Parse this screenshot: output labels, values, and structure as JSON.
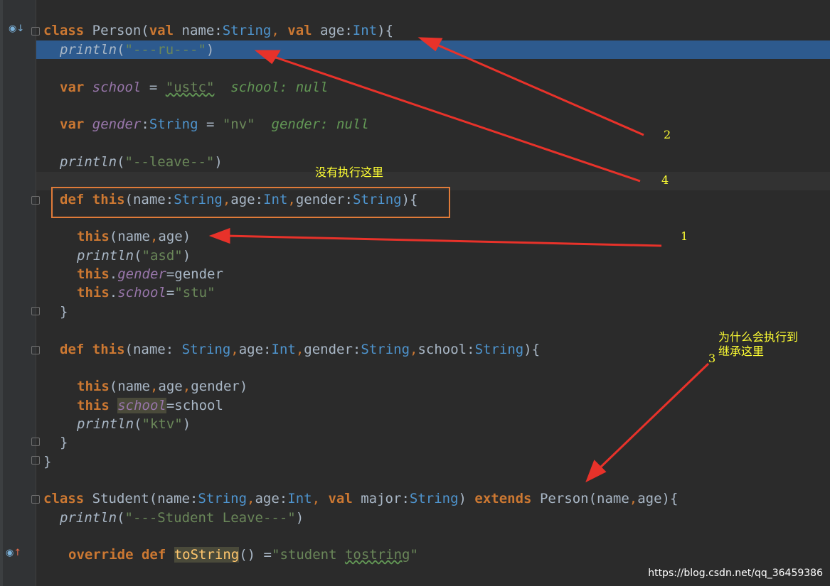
{
  "code": {
    "line_class_person": {
      "kw1": "class",
      "name": "Person(",
      "kw2": "val",
      "p1": " name",
      "c1": ":",
      "t1": "String",
      "sep": ", ",
      "kw3": "val",
      "p2": " age",
      "c2": ":",
      "t2": "Int",
      "end": "){"
    },
    "line_println_ru": {
      "fn": "println",
      "open": "(",
      "str": "\"---ru---\"",
      "close": ")"
    },
    "line_var_school": {
      "kw": "var",
      "name": "school",
      "eq": " = ",
      "str": "\"ustc\"",
      "hint": "school: null"
    },
    "line_var_gender": {
      "kw": "var",
      "name": "gender",
      "c": ":",
      "t": "String",
      "eq": " = ",
      "str": "\"nv\"",
      "hint": "gender: null"
    },
    "line_println_leave": {
      "fn": "println",
      "open": "(",
      "str": "\"--leave--\"",
      "close": ")"
    },
    "line_def_this_3": {
      "kw1": "def",
      "kw2": "this",
      "open": "(name",
      "c1": ":",
      "t1": "String",
      "s1": ",",
      "p2": "age",
      "c2": ":",
      "t2": "Int",
      "s2": ",",
      "p3": "gender",
      "c3": ":",
      "t3": "String",
      "end": "){"
    },
    "line_this_name_age": {
      "kw": "this",
      "rest": "(name",
      "s": ",",
      "rest2": "age)"
    },
    "line_println_asd": {
      "fn": "println",
      "open": "(",
      "str": "\"asd\"",
      "close": ")"
    },
    "line_this_gender": {
      "kw": "this",
      "dot": ".",
      "fld": "gender",
      "rest": "=gender"
    },
    "line_this_school": {
      "kw": "this",
      "dot": ".",
      "fld": "school",
      "eq": "=",
      "str": "\"stu\""
    },
    "close_brace_1": "}",
    "line_def_this_4": {
      "kw1": "def",
      "kw2": "this",
      "open": "(name: ",
      "t1": "String",
      "s1": ",",
      "p2": "age",
      "c2": ":",
      "t2": "Int",
      "s2": ",",
      "p3": "gender",
      "c3": ":",
      "t3": "String",
      "s3": ",",
      "p4": "school",
      "c4": ":",
      "t4": "String",
      "end": "){"
    },
    "line_this_ngd": {
      "kw": "this",
      "rest": "(name",
      "s1": ",",
      "r2": "age",
      "s2": ",",
      "r3": "gender)"
    },
    "line_this_school2": {
      "kw": "this",
      "sp": " ",
      "fld": "school",
      "rest": "=school"
    },
    "line_println_ktv": {
      "fn": "println",
      "open": "(",
      "str": "\"ktv\"",
      "close": ")"
    },
    "close_brace_2": "}",
    "close_brace_3": "}",
    "line_class_student": {
      "kw1": "class",
      "name": " Student(name",
      "c1": ":",
      "t1": "String",
      "s1": ",",
      "p2": "age",
      "c2": ":",
      "t2": "Int",
      "s2": ",",
      "kw2": " val",
      "p3": " major",
      "c3": ":",
      "t3": "String",
      "mid": ") ",
      "kw3": "extends",
      "rest": " Person(name",
      "s3": ",",
      "r4": "age){"
    },
    "line_println_student": {
      "fn": "println",
      "open": "(",
      "str": "\"---Student Leave---\"",
      "close": ")"
    },
    "line_override": {
      "kw1": "override",
      "kw2": " def ",
      "fn": "toString",
      "rest": "() =",
      "str_a": "\"student ",
      "str_b": "tostring",
      "str_c": "\""
    }
  },
  "annotations": {
    "not_executed": "没有执行这里",
    "why_inherit_l1": "为什么会执行到",
    "why_inherit_l2": "继承这里",
    "n1": "1",
    "n2": "2",
    "n3": "3",
    "n4": "4"
  },
  "colors": {
    "arrow": "#e8322a",
    "annotation_text": "#ffff33",
    "box": "#e07b39",
    "selection": "#2d5a8e"
  },
  "watermark": "https://blog.csdn.net/qq_36459386"
}
